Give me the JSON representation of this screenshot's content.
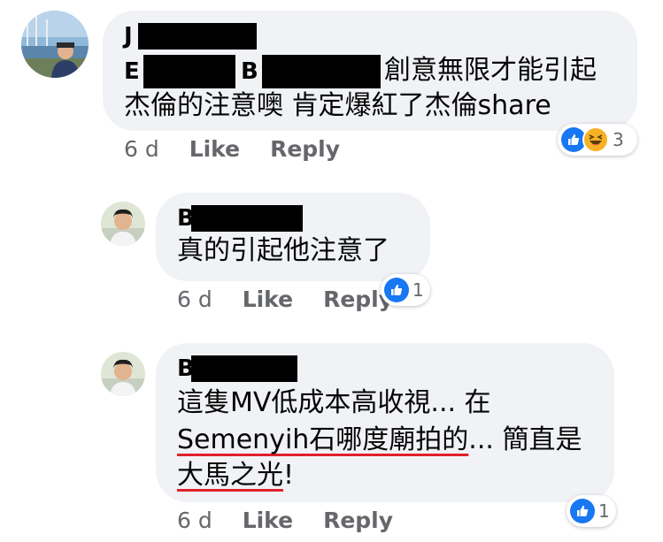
{
  "comments": [
    {
      "name_visible": "J",
      "body_line1_prefix_a": "E",
      "body_line1_prefix_b": "B",
      "body_line1_text": "創意無限才能引起",
      "body_line2_text": "杰倫的注意噢 肯定爆紅了杰倫share",
      "time": "6 d",
      "like_label": "Like",
      "reply_label": "Reply",
      "reaction_icons": [
        "like-icon",
        "laugh-icon"
      ],
      "reaction_count": "3"
    },
    {
      "name_visible": "B",
      "body_text": "真的引起他注意了",
      "time": "6 d",
      "like_label": "Like",
      "reply_label": "Reply",
      "reaction_icons": [
        "like-icon"
      ],
      "reaction_count": "1"
    },
    {
      "name_visible": "B",
      "body_line1_text": "這隻MV低成本高收視... 在",
      "body_line2_underlined": "Semenyih石哪度廟拍的",
      "body_line2_rest": "... 簡直是",
      "body_line3_underlined": "大馬之光",
      "body_line3_rest": "!",
      "time": "6 d",
      "like_label": "Like",
      "reply_label": "Reply",
      "reaction_icons": [
        "like-icon"
      ],
      "reaction_count": "1"
    }
  ],
  "colors": {
    "bubble_bg": "#f0f2f5",
    "like_blue": "#1877f2",
    "laugh_yellow": "#f7b125",
    "underline_red": "#e0212b",
    "meta_gray": "#65676b"
  }
}
